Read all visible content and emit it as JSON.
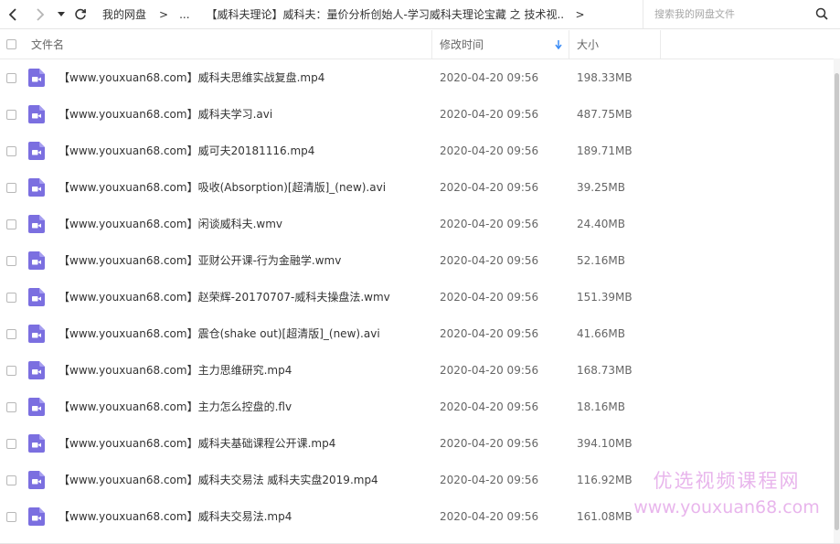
{
  "nav": {
    "back_icon": "chevron-left-icon",
    "forward_icon": "chevron-right-icon",
    "dropdown_icon": "caret-down-icon",
    "refresh_icon": "refresh-icon"
  },
  "breadcrumb": {
    "root": "我的网盘",
    "sep1": ">",
    "ellipsis": "...",
    "current": "【威科夫理论】威科夫：量价分析创始人-学习威科夫理论宝藏 之 技术视...",
    "sep2": ">"
  },
  "search": {
    "placeholder": "搜索我的网盘文件",
    "value": ""
  },
  "columns": {
    "name": "文件名",
    "modified": "修改时间",
    "size": "大小",
    "sort_icon": "sort-down-arrow-icon"
  },
  "files": [
    {
      "name": "【www.youxuan68.com】威科夫思维实战复盘.mp4",
      "modified": "2020-04-20 09:56",
      "size": "198.33MB"
    },
    {
      "name": "【www.youxuan68.com】威科夫学习.avi",
      "modified": "2020-04-20 09:56",
      "size": "487.75MB"
    },
    {
      "name": "【www.youxuan68.com】威可夫20181116.mp4",
      "modified": "2020-04-20 09:56",
      "size": "189.71MB"
    },
    {
      "name": "【www.youxuan68.com】吸收(Absorption)[超清版]_(new).avi",
      "modified": "2020-04-20 09:56",
      "size": "39.25MB"
    },
    {
      "name": "【www.youxuan68.com】闲谈威科夫.wmv",
      "modified": "2020-04-20 09:56",
      "size": "24.40MB"
    },
    {
      "name": "【www.youxuan68.com】亚财公开课-行为金融学.wmv",
      "modified": "2020-04-20 09:56",
      "size": "52.16MB"
    },
    {
      "name": "【www.youxuan68.com】赵荣辉-20170707-威科夫操盘法.wmv",
      "modified": "2020-04-20 09:56",
      "size": "151.39MB"
    },
    {
      "name": "【www.youxuan68.com】震仓(shake out)[超清版]_(new).avi",
      "modified": "2020-04-20 09:56",
      "size": "41.66MB"
    },
    {
      "name": "【www.youxuan68.com】主力思维研究.mp4",
      "modified": "2020-04-20 09:56",
      "size": "168.73MB"
    },
    {
      "name": "【www.youxuan68.com】主力怎么控盘的.flv",
      "modified": "2020-04-20 09:56",
      "size": "18.16MB"
    },
    {
      "name": "【www.youxuan68.com】威科夫基础课程公开课.mp4",
      "modified": "2020-04-20 09:56",
      "size": "394.10MB"
    },
    {
      "name": "【www.youxuan68.com】威科夫交易法 威科夫实盘2019.mp4",
      "modified": "2020-04-20 09:56",
      "size": "116.92MB"
    },
    {
      "name": "【www.youxuan68.com】威科夫交易法.mp4",
      "modified": "2020-04-20 09:56",
      "size": "161.08MB"
    }
  ],
  "file_icon": "video-file-icon",
  "watermark": {
    "cn": "优选视频课程网",
    "url": "www.youxuan68.com"
  },
  "colors": {
    "video_icon": "#7b6fe0",
    "sort_arrow": "#3b8cf5",
    "watermark": "#d678dc"
  }
}
